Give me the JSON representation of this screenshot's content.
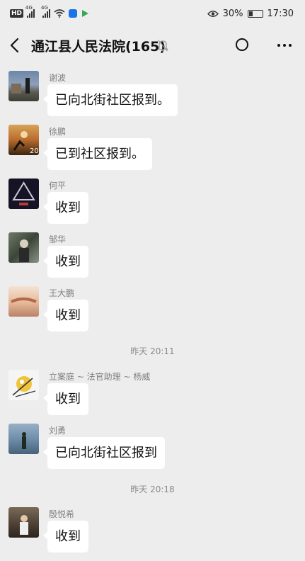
{
  "status_bar": {
    "hd_label": "HD",
    "signal1_label": "4G",
    "signal2_label": "4G",
    "battery_percent": "30%",
    "time": "17:30",
    "battery_level": 0.3
  },
  "header": {
    "title": "通江县人民法院(165)"
  },
  "messages": [
    {
      "sender": "谢波",
      "text": "已向北街社区报到。"
    },
    {
      "sender": "徐鹏",
      "text": "已到社区报到。"
    },
    {
      "sender": "何平",
      "text": "收到"
    },
    {
      "sender": "邹华",
      "text": "收到"
    },
    {
      "sender": "王大鹏",
      "text": "收到"
    },
    {
      "sender": "立案庭 ~ 法官助理 ~ 杨威",
      "text": "收到"
    },
    {
      "sender": "刘勇",
      "text": "已向北街社区报到"
    },
    {
      "sender": "殷悦希",
      "text": "收到"
    }
  ],
  "timestamps": [
    {
      "text": "昨天 20:11"
    },
    {
      "text": "昨天 20:18"
    }
  ],
  "colors": {
    "background": "#ededed",
    "bubble": "#ffffff",
    "meta_text": "#7f7f7f"
  }
}
